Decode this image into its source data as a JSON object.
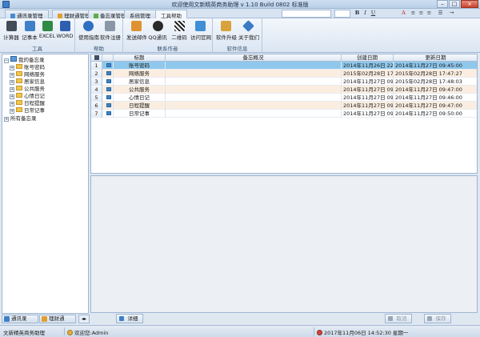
{
  "window": {
    "title": "欢迎使用文新精英商务助理  v 1.10 Build 0802  标准版",
    "min": "–",
    "max": "□",
    "close": "×"
  },
  "tabs": [
    {
      "label": "通讯录管理"
    },
    {
      "label": "理财通管理"
    },
    {
      "label": "备忘录管理"
    },
    {
      "label": "系统管理"
    },
    {
      "label": "工具帮助"
    }
  ],
  "format_toolbar": {
    "bold": "B",
    "italic": "I",
    "underline": "U",
    "font_color": "A"
  },
  "ribbon": {
    "groups": [
      {
        "caption": "工具",
        "buttons": [
          {
            "label": "计算器"
          },
          {
            "label": "记事本"
          },
          {
            "label": "EXCEL"
          },
          {
            "label": "WORD"
          }
        ]
      },
      {
        "caption": "帮助",
        "buttons": [
          {
            "label": "使用指南"
          },
          {
            "label": "软件注册"
          }
        ]
      },
      {
        "caption": "联系作者",
        "buttons": [
          {
            "label": "发送邮件"
          },
          {
            "label": "QQ通讯"
          },
          {
            "label": "二维码"
          },
          {
            "label": "访问官网"
          }
        ]
      },
      {
        "caption": "软件信息",
        "buttons": [
          {
            "label": "软件升级"
          },
          {
            "label": "关于我们"
          }
        ]
      }
    ]
  },
  "tree": {
    "root": "我的备忘录",
    "children": [
      "账号密码",
      "网络服务",
      "居家信息",
      "公共服务",
      "心情日记",
      "日程提醒",
      "日常记事"
    ],
    "other": "所有备忘录",
    "expand": "+",
    "collapse": "−"
  },
  "left_tabs": [
    {
      "label": "通讯录"
    },
    {
      "label": "理财通"
    }
  ],
  "nav_arrows": "◂▸",
  "grid": {
    "columns": [
      "标题",
      "备忘概况",
      "创建日期",
      "更新日期"
    ],
    "rows": [
      {
        "num": "1",
        "title": "账号密码",
        "summary": "",
        "created": "2014年11月26日 22",
        "updated": "2014年11月27日 09:45:00"
      },
      {
        "num": "2",
        "title": "网络服务",
        "summary": "",
        "created": "2015年02月28日 17",
        "updated": "2015年02月28日 17:47:27"
      },
      {
        "num": "3",
        "title": "居家信息",
        "summary": "",
        "created": "2014年11月27日 09",
        "updated": "2015年02月28日 17:48:03"
      },
      {
        "num": "4",
        "title": "公共服务",
        "summary": "",
        "created": "2014年11月27日 09",
        "updated": "2014年11月27日 09:47:00"
      },
      {
        "num": "5",
        "title": "心情日记",
        "summary": "",
        "created": "2014年11月27日 09",
        "updated": "2014年11月27日 09:46:00"
      },
      {
        "num": "6",
        "title": "日程提醒",
        "summary": "",
        "created": "2014年11月27日 09",
        "updated": "2014年11月27日 09:47:00"
      },
      {
        "num": "7",
        "title": "日常记事",
        "summary": "",
        "created": "2014年11月27日 09",
        "updated": "2014年11月27日 09:50:00"
      }
    ]
  },
  "actions": {
    "detail": "详细",
    "cancel": "取消",
    "save": "保存"
  },
  "status": {
    "app_name": "文新精英商务助理",
    "welcome": "欢迎您:Admin",
    "datetime": "2017年11月06日  14:52:30  星期一"
  },
  "colors": {
    "selected_row": "#8fc8ec",
    "alt_row": "#fbeee0",
    "accent": "#3f7fc8"
  }
}
